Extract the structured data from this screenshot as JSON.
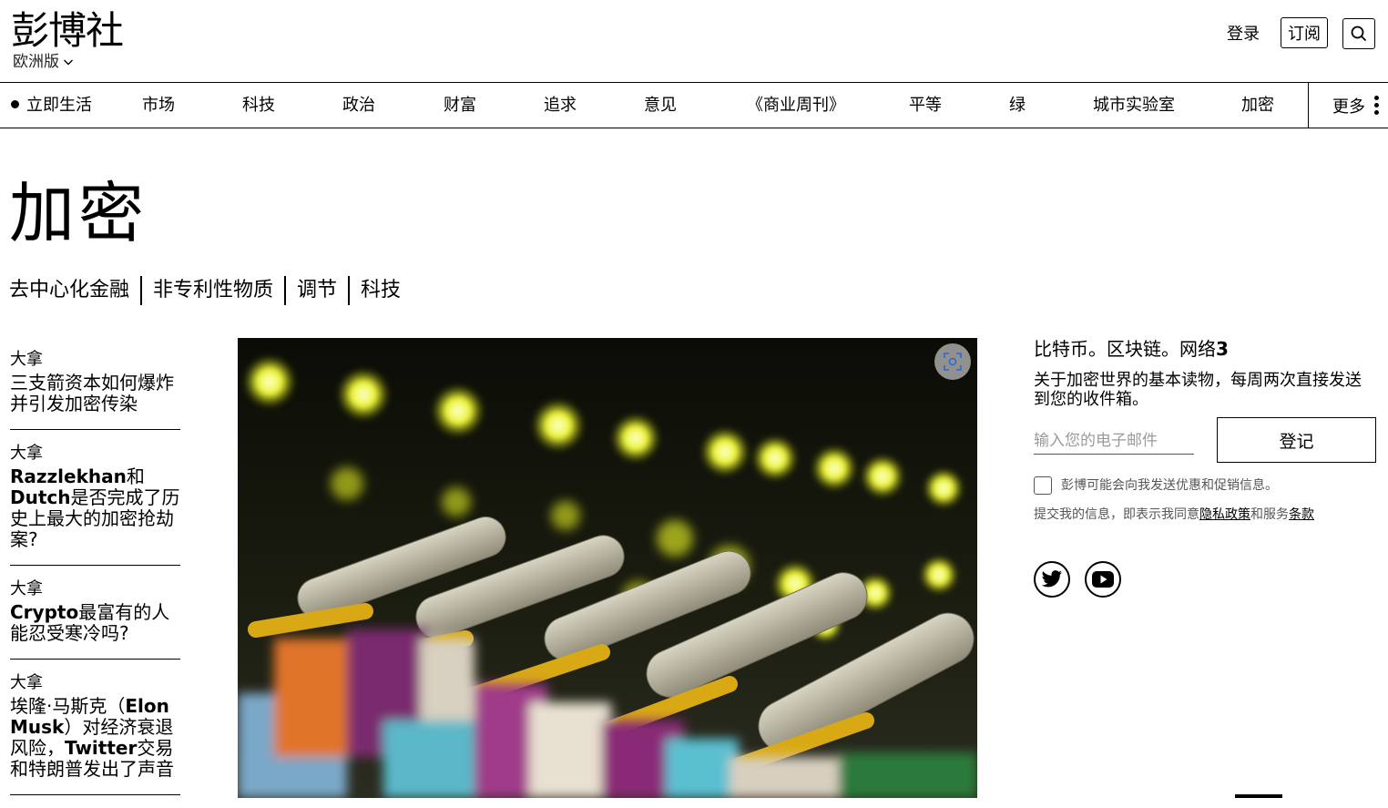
{
  "header": {
    "logo": "彭博社",
    "edition": "欧洲版",
    "signin_label": "登录",
    "subscribe_label": "订阅"
  },
  "nav": {
    "live_label": "立即生活",
    "items": [
      "市场",
      "科技",
      "政治",
      "财富",
      "追求",
      "意见",
      "《商业周刊》",
      "平等",
      "绿",
      "城市实验室",
      "加密"
    ],
    "more_label": "更多"
  },
  "page": {
    "title": "加密",
    "subnav": [
      "去中心化金融",
      "非专利性物质",
      "调节",
      "科技"
    ]
  },
  "stories": [
    {
      "category": "大拿",
      "headline_parts": [
        {
          "text": "三支箭资本如何爆炸并引发加密传染",
          "bold": false
        }
      ]
    },
    {
      "category": "大拿",
      "headline_parts": [
        {
          "text": "Razzlekhan",
          "bold": true
        },
        {
          "text": "和",
          "bold": false
        },
        {
          "text": "Dutch",
          "bold": true
        },
        {
          "text": "是否完成了历史上最大的加密抢劫案?",
          "bold": false
        }
      ]
    },
    {
      "category": "大拿",
      "headline_parts": [
        {
          "text": "Crypto",
          "bold": true
        },
        {
          "text": "最富有的人能忍受寒冷吗?",
          "bold": false
        }
      ]
    },
    {
      "category": "大拿",
      "headline_parts": [
        {
          "text": "埃隆·马斯克（",
          "bold": false
        },
        {
          "text": "Elon Musk",
          "bold": true
        },
        {
          "text": "）对经济衰退风险，",
          "bold": false
        },
        {
          "text": "Twitter",
          "bold": true
        },
        {
          "text": "交易和特朗普发出了声音",
          "bold": false
        }
      ]
    }
  ],
  "newsletter": {
    "title_prefix": "比特币。区块链。网络",
    "title_suffix": "3",
    "description": "关于加密世界的基本读物，每周两次直接发送到您的收件箱。",
    "email_placeholder": "输入您的电子邮件",
    "submit_label": "登记",
    "checkbox_label": "彭博可能会向我发送优惠和促销信息。",
    "legal_prefix": "提交我的信息，即表示我同意",
    "privacy_link": "隐私政策",
    "legal_middle": "和服务",
    "terms_link": "条款"
  },
  "social": [
    "twitter-icon",
    "youtube-icon"
  ],
  "colors": {
    "text": "#000000",
    "muted": "#555555",
    "placeholder": "#9a9a9a",
    "led_yellow": "#e8f22a"
  }
}
